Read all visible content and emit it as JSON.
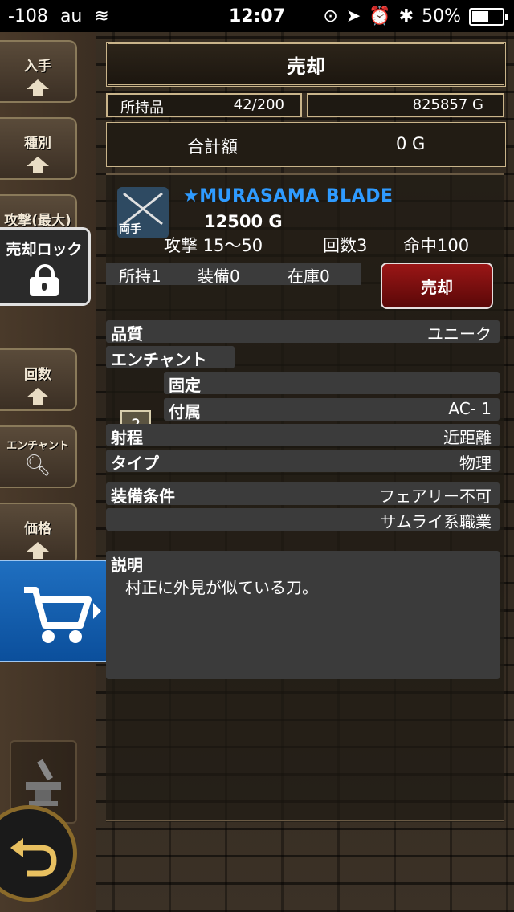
{
  "status_bar": {
    "signal": "-108",
    "carrier": "au",
    "time": "12:07",
    "battery": "50%"
  },
  "sidebar": {
    "sort_buttons": [
      "入手",
      "種別",
      "攻撃(最大)"
    ],
    "lock_label": "売却ロック",
    "sort_buttons_2": [
      "回数",
      "エンチャント",
      "価格"
    ]
  },
  "header": {
    "title": "売却",
    "inventory_label": "所持品",
    "inventory_value": "42/200",
    "gold": "825857 G",
    "total_label": "合計額",
    "total_value": "0 G"
  },
  "item": {
    "hand_tag": "両手",
    "name": "★MURASAMA BLADE",
    "price": "12500 G",
    "attack": "攻撃 15～50",
    "uses": "回数3",
    "accuracy": "命中100",
    "owned": "所持1",
    "equipped": "装備0",
    "stock": "在庫0",
    "sell_label": "売却"
  },
  "details": {
    "quality_label": "品質",
    "quality_value": "ユニーク",
    "enchant_label": "エンチャント",
    "fixed_label": "固定",
    "fixed_value": "",
    "attached_label": "付属",
    "attached_value": "AC- 1",
    "question": "?",
    "range_label": "射程",
    "range_value": "近距離",
    "type_label": "タイプ",
    "type_value": "物理",
    "equip_label": "装備条件",
    "equip_value_1": "フェアリー不可",
    "equip_value_2": "サムライ系職業",
    "desc_label": "説明",
    "desc_value": "村正に外見が似ている刀。"
  },
  "colors": {
    "item_name": "#2f9bff",
    "sell_button": "#8a1010",
    "cart_button": "#1463b4"
  }
}
